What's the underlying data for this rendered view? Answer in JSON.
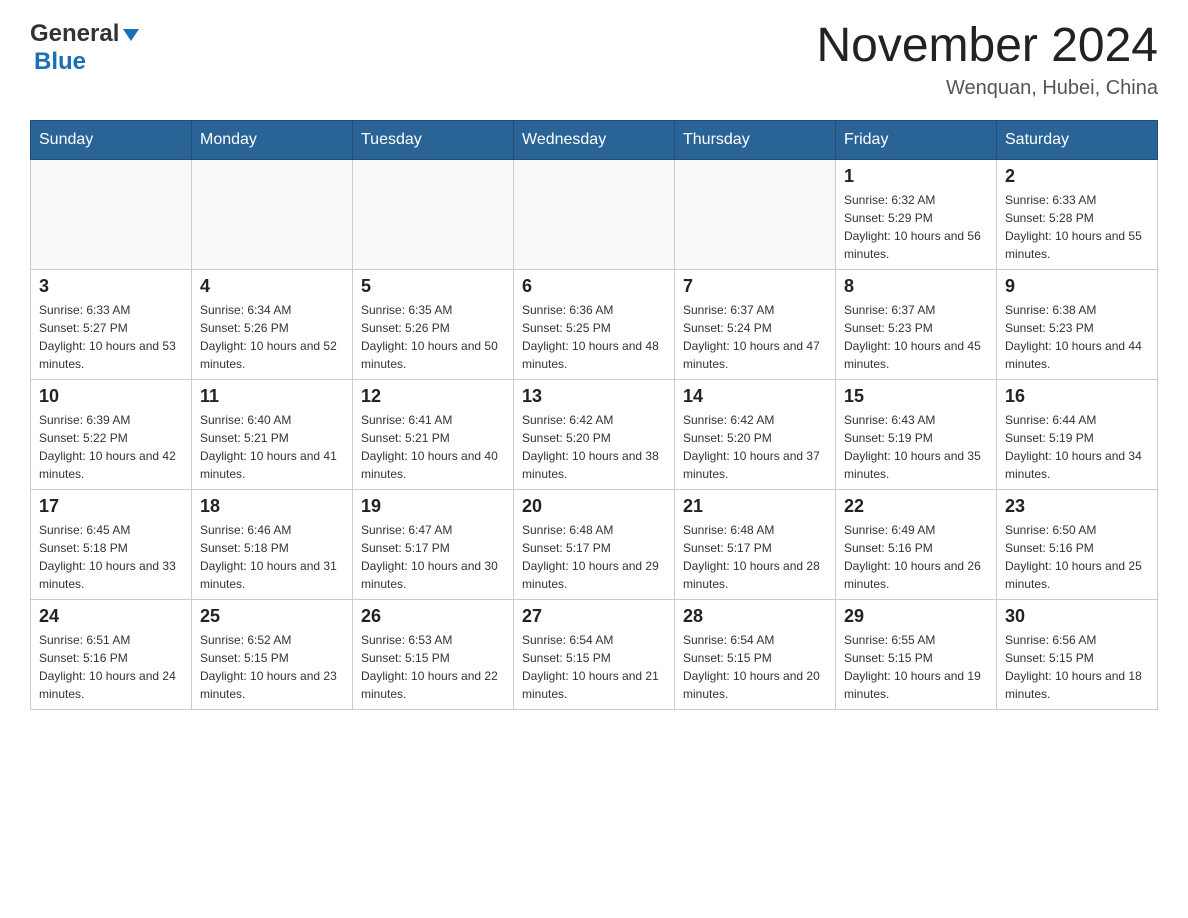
{
  "header": {
    "title": "November 2024",
    "location": "Wenquan, Hubei, China",
    "logo_text1": "General",
    "logo_text2": "Blue"
  },
  "days_of_week": [
    "Sunday",
    "Monday",
    "Tuesday",
    "Wednesday",
    "Thursday",
    "Friday",
    "Saturday"
  ],
  "weeks": [
    [
      {
        "day": "",
        "sunrise": "",
        "sunset": "",
        "daylight": ""
      },
      {
        "day": "",
        "sunrise": "",
        "sunset": "",
        "daylight": ""
      },
      {
        "day": "",
        "sunrise": "",
        "sunset": "",
        "daylight": ""
      },
      {
        "day": "",
        "sunrise": "",
        "sunset": "",
        "daylight": ""
      },
      {
        "day": "",
        "sunrise": "",
        "sunset": "",
        "daylight": ""
      },
      {
        "day": "1",
        "sunrise": "Sunrise: 6:32 AM",
        "sunset": "Sunset: 5:29 PM",
        "daylight": "Daylight: 10 hours and 56 minutes."
      },
      {
        "day": "2",
        "sunrise": "Sunrise: 6:33 AM",
        "sunset": "Sunset: 5:28 PM",
        "daylight": "Daylight: 10 hours and 55 minutes."
      }
    ],
    [
      {
        "day": "3",
        "sunrise": "Sunrise: 6:33 AM",
        "sunset": "Sunset: 5:27 PM",
        "daylight": "Daylight: 10 hours and 53 minutes."
      },
      {
        "day": "4",
        "sunrise": "Sunrise: 6:34 AM",
        "sunset": "Sunset: 5:26 PM",
        "daylight": "Daylight: 10 hours and 52 minutes."
      },
      {
        "day": "5",
        "sunrise": "Sunrise: 6:35 AM",
        "sunset": "Sunset: 5:26 PM",
        "daylight": "Daylight: 10 hours and 50 minutes."
      },
      {
        "day": "6",
        "sunrise": "Sunrise: 6:36 AM",
        "sunset": "Sunset: 5:25 PM",
        "daylight": "Daylight: 10 hours and 48 minutes."
      },
      {
        "day": "7",
        "sunrise": "Sunrise: 6:37 AM",
        "sunset": "Sunset: 5:24 PM",
        "daylight": "Daylight: 10 hours and 47 minutes."
      },
      {
        "day": "8",
        "sunrise": "Sunrise: 6:37 AM",
        "sunset": "Sunset: 5:23 PM",
        "daylight": "Daylight: 10 hours and 45 minutes."
      },
      {
        "day": "9",
        "sunrise": "Sunrise: 6:38 AM",
        "sunset": "Sunset: 5:23 PM",
        "daylight": "Daylight: 10 hours and 44 minutes."
      }
    ],
    [
      {
        "day": "10",
        "sunrise": "Sunrise: 6:39 AM",
        "sunset": "Sunset: 5:22 PM",
        "daylight": "Daylight: 10 hours and 42 minutes."
      },
      {
        "day": "11",
        "sunrise": "Sunrise: 6:40 AM",
        "sunset": "Sunset: 5:21 PM",
        "daylight": "Daylight: 10 hours and 41 minutes."
      },
      {
        "day": "12",
        "sunrise": "Sunrise: 6:41 AM",
        "sunset": "Sunset: 5:21 PM",
        "daylight": "Daylight: 10 hours and 40 minutes."
      },
      {
        "day": "13",
        "sunrise": "Sunrise: 6:42 AM",
        "sunset": "Sunset: 5:20 PM",
        "daylight": "Daylight: 10 hours and 38 minutes."
      },
      {
        "day": "14",
        "sunrise": "Sunrise: 6:42 AM",
        "sunset": "Sunset: 5:20 PM",
        "daylight": "Daylight: 10 hours and 37 minutes."
      },
      {
        "day": "15",
        "sunrise": "Sunrise: 6:43 AM",
        "sunset": "Sunset: 5:19 PM",
        "daylight": "Daylight: 10 hours and 35 minutes."
      },
      {
        "day": "16",
        "sunrise": "Sunrise: 6:44 AM",
        "sunset": "Sunset: 5:19 PM",
        "daylight": "Daylight: 10 hours and 34 minutes."
      }
    ],
    [
      {
        "day": "17",
        "sunrise": "Sunrise: 6:45 AM",
        "sunset": "Sunset: 5:18 PM",
        "daylight": "Daylight: 10 hours and 33 minutes."
      },
      {
        "day": "18",
        "sunrise": "Sunrise: 6:46 AM",
        "sunset": "Sunset: 5:18 PM",
        "daylight": "Daylight: 10 hours and 31 minutes."
      },
      {
        "day": "19",
        "sunrise": "Sunrise: 6:47 AM",
        "sunset": "Sunset: 5:17 PM",
        "daylight": "Daylight: 10 hours and 30 minutes."
      },
      {
        "day": "20",
        "sunrise": "Sunrise: 6:48 AM",
        "sunset": "Sunset: 5:17 PM",
        "daylight": "Daylight: 10 hours and 29 minutes."
      },
      {
        "day": "21",
        "sunrise": "Sunrise: 6:48 AM",
        "sunset": "Sunset: 5:17 PM",
        "daylight": "Daylight: 10 hours and 28 minutes."
      },
      {
        "day": "22",
        "sunrise": "Sunrise: 6:49 AM",
        "sunset": "Sunset: 5:16 PM",
        "daylight": "Daylight: 10 hours and 26 minutes."
      },
      {
        "day": "23",
        "sunrise": "Sunrise: 6:50 AM",
        "sunset": "Sunset: 5:16 PM",
        "daylight": "Daylight: 10 hours and 25 minutes."
      }
    ],
    [
      {
        "day": "24",
        "sunrise": "Sunrise: 6:51 AM",
        "sunset": "Sunset: 5:16 PM",
        "daylight": "Daylight: 10 hours and 24 minutes."
      },
      {
        "day": "25",
        "sunrise": "Sunrise: 6:52 AM",
        "sunset": "Sunset: 5:15 PM",
        "daylight": "Daylight: 10 hours and 23 minutes."
      },
      {
        "day": "26",
        "sunrise": "Sunrise: 6:53 AM",
        "sunset": "Sunset: 5:15 PM",
        "daylight": "Daylight: 10 hours and 22 minutes."
      },
      {
        "day": "27",
        "sunrise": "Sunrise: 6:54 AM",
        "sunset": "Sunset: 5:15 PM",
        "daylight": "Daylight: 10 hours and 21 minutes."
      },
      {
        "day": "28",
        "sunrise": "Sunrise: 6:54 AM",
        "sunset": "Sunset: 5:15 PM",
        "daylight": "Daylight: 10 hours and 20 minutes."
      },
      {
        "day": "29",
        "sunrise": "Sunrise: 6:55 AM",
        "sunset": "Sunset: 5:15 PM",
        "daylight": "Daylight: 10 hours and 19 minutes."
      },
      {
        "day": "30",
        "sunrise": "Sunrise: 6:56 AM",
        "sunset": "Sunset: 5:15 PM",
        "daylight": "Daylight: 10 hours and 18 minutes."
      }
    ]
  ]
}
